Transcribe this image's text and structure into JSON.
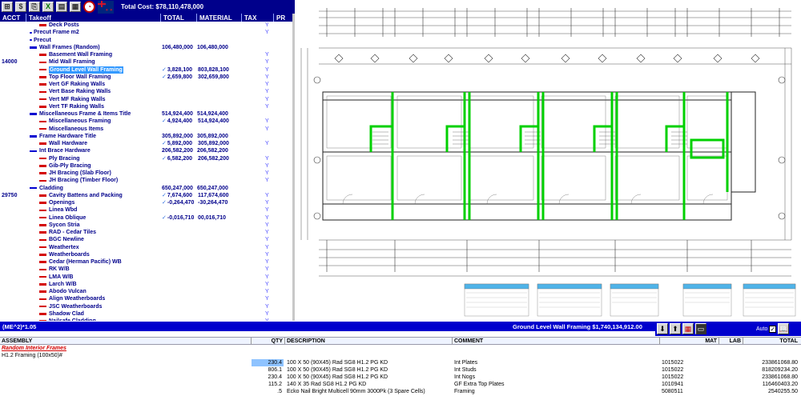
{
  "toolbar": {
    "total_cost": "Total Cost: $78,110,478,000"
  },
  "tree_header": {
    "acct": "ACCT",
    "takeoff": "Takeoff",
    "total": "TOTAL",
    "material": "MATERIAL",
    "tax": "TAX",
    "pr": "PR"
  },
  "tree_rows": [
    {
      "acct": "",
      "indent": 1,
      "bullet": "red",
      "name": "Deck Posts",
      "total": "",
      "material": "",
      "check": false,
      "y": "Y"
    },
    {
      "acct": "",
      "indent": 0,
      "bullet": "dot",
      "name": "Precut Frame m2",
      "total": "",
      "material": "",
      "check": false,
      "y": "Y"
    },
    {
      "acct": "",
      "indent": 0,
      "bullet": "dot",
      "name": "Precut",
      "total": "",
      "material": "",
      "check": false,
      "y": ""
    },
    {
      "acct": "",
      "indent": 0,
      "bullet": "blue",
      "name": "Wall Frames (Random)",
      "total": "106,480,000",
      "material": "106,480,000",
      "check": false,
      "y": ""
    },
    {
      "acct": "",
      "indent": 1,
      "bullet": "red",
      "name": "Basement Wall Framing",
      "total": "",
      "material": "",
      "check": false,
      "y": "Y"
    },
    {
      "acct": "14000",
      "indent": 1,
      "bullet": "red",
      "name": "Mid Wall Framing",
      "total": "",
      "material": "",
      "check": false,
      "y": "Y"
    },
    {
      "acct": "",
      "indent": 1,
      "bullet": "red",
      "name": "Ground Level Wall Framing",
      "total": "3,828,100",
      "material": "803,828,100",
      "check": true,
      "y": "Y",
      "selected": true
    },
    {
      "acct": "",
      "indent": 1,
      "bullet": "red",
      "name": "Top Floor Wall Framing",
      "total": "2,659,800",
      "material": "302,659,800",
      "check": true,
      "y": "Y"
    },
    {
      "acct": "",
      "indent": 1,
      "bullet": "red",
      "name": "Vert GF Raking Walls",
      "total": "",
      "material": "",
      "check": false,
      "y": "Y"
    },
    {
      "acct": "",
      "indent": 1,
      "bullet": "red",
      "name": "Vert Base Raking Walls",
      "total": "",
      "material": "",
      "check": false,
      "y": "Y"
    },
    {
      "acct": "",
      "indent": 1,
      "bullet": "red",
      "name": "Vert MF Raking Walls",
      "total": "",
      "material": "",
      "check": false,
      "y": "Y"
    },
    {
      "acct": "",
      "indent": 1,
      "bullet": "red",
      "name": "Vert TF Raking Walls",
      "total": "",
      "material": "",
      "check": false,
      "y": "Y"
    },
    {
      "acct": "",
      "indent": 0,
      "bullet": "blue",
      "name": "Miscellaneous Frame & Items Title",
      "total": "514,924,400",
      "material": "514,924,400",
      "check": false,
      "y": ""
    },
    {
      "acct": "",
      "indent": 1,
      "bullet": "red",
      "name": "Miscellaneous Framing",
      "total": "4,924,400",
      "material": "514,924,400",
      "check": true,
      "y": "Y"
    },
    {
      "acct": "",
      "indent": 1,
      "bullet": "red",
      "name": "Miscellaneous Items",
      "total": "",
      "material": "",
      "check": false,
      "y": "Y"
    },
    {
      "acct": "",
      "indent": 0,
      "bullet": "blue",
      "name": "Frame Hardware Title",
      "total": "305,892,000",
      "material": "305,892,000",
      "check": false,
      "y": ""
    },
    {
      "acct": "",
      "indent": 1,
      "bullet": "red",
      "name": "Wall Hardware",
      "total": "5,892,000",
      "material": "305,892,000",
      "check": true,
      "y": "Y"
    },
    {
      "acct": "",
      "indent": 0,
      "bullet": "blue",
      "name": "Int Brace Hardware",
      "total": "206,582,200",
      "material": "206,582,200",
      "check": false,
      "y": ""
    },
    {
      "acct": "",
      "indent": 1,
      "bullet": "red",
      "name": "Ply Bracing",
      "total": "6,582,200",
      "material": "206,582,200",
      "check": true,
      "y": "Y"
    },
    {
      "acct": "",
      "indent": 1,
      "bullet": "red",
      "name": "Gib-Ply Bracing",
      "total": "",
      "material": "",
      "check": false,
      "y": "Y"
    },
    {
      "acct": "",
      "indent": 1,
      "bullet": "red",
      "name": "JH Bracing (Slab Floor)",
      "total": "",
      "material": "",
      "check": false,
      "y": "Y"
    },
    {
      "acct": "",
      "indent": 1,
      "bullet": "red",
      "name": "JH Bracing (Timber Floor)",
      "total": "",
      "material": "",
      "check": false,
      "y": "Y"
    },
    {
      "acct": "",
      "indent": 0,
      "bullet": "blue",
      "name": "Cladding",
      "total": "650,247,000",
      "material": "650,247,000",
      "check": false,
      "y": ""
    },
    {
      "acct": "29750",
      "indent": 1,
      "bullet": "red",
      "name": "Cavity Battens and Packing",
      "total": "7,674,600",
      "material": "117,674,600",
      "check": true,
      "y": "Y"
    },
    {
      "acct": "",
      "indent": 1,
      "bullet": "red",
      "name": "Openings",
      "total": "-0,264,470",
      "material": "-30,264,470",
      "check": true,
      "y": "Y"
    },
    {
      "acct": "",
      "indent": 1,
      "bullet": "red",
      "name": "Linea Wbd",
      "total": "",
      "material": "",
      "check": false,
      "y": "Y"
    },
    {
      "acct": "",
      "indent": 1,
      "bullet": "red",
      "name": "Linea Oblique",
      "total": "-0,016,710",
      "material": "00,016,710",
      "check": true,
      "y": "Y"
    },
    {
      "acct": "",
      "indent": 1,
      "bullet": "red",
      "name": "Sycon Stria",
      "total": "",
      "material": "",
      "check": false,
      "y": "Y"
    },
    {
      "acct": "",
      "indent": 1,
      "bullet": "red",
      "name": "RAD - Cedar Tiles",
      "total": "",
      "material": "",
      "check": false,
      "y": "Y"
    },
    {
      "acct": "",
      "indent": 1,
      "bullet": "red",
      "name": "BGC Newline",
      "total": "",
      "material": "",
      "check": false,
      "y": "Y"
    },
    {
      "acct": "",
      "indent": 1,
      "bullet": "red",
      "name": "Weathertex",
      "total": "",
      "material": "",
      "check": false,
      "y": "Y"
    },
    {
      "acct": "",
      "indent": 1,
      "bullet": "red",
      "name": "Weatherboards",
      "total": "",
      "material": "",
      "check": false,
      "y": "Y"
    },
    {
      "acct": "",
      "indent": 1,
      "bullet": "red",
      "name": "Cedar (Herman Pacific) WB",
      "total": "",
      "material": "",
      "check": false,
      "y": "Y"
    },
    {
      "acct": "",
      "indent": 1,
      "bullet": "red",
      "name": "RK W/B",
      "total": "",
      "material": "",
      "check": false,
      "y": "Y"
    },
    {
      "acct": "",
      "indent": 1,
      "bullet": "red",
      "name": "LMA W/B",
      "total": "",
      "material": "",
      "check": false,
      "y": "Y"
    },
    {
      "acct": "",
      "indent": 1,
      "bullet": "red",
      "name": "Larch W/B",
      "total": "",
      "material": "",
      "check": false,
      "y": "Y"
    },
    {
      "acct": "",
      "indent": 1,
      "bullet": "red",
      "name": "Abodo Vulcan",
      "total": "",
      "material": "",
      "check": false,
      "y": "Y"
    },
    {
      "acct": "",
      "indent": 1,
      "bullet": "red",
      "name": "Align Weatherboards",
      "total": "",
      "material": "",
      "check": false,
      "y": "Y"
    },
    {
      "acct": "",
      "indent": 1,
      "bullet": "red",
      "name": "JSC Weatherboards",
      "total": "",
      "material": "",
      "check": false,
      "y": "Y"
    },
    {
      "acct": "",
      "indent": 1,
      "bullet": "red",
      "name": "Shadow Clad",
      "total": "",
      "material": "",
      "check": false,
      "y": "Y"
    },
    {
      "acct": "",
      "indent": 1,
      "bullet": "red",
      "name": "Nailsafe Cladding",
      "total": "",
      "material": "",
      "check": false,
      "y": "Y"
    }
  ],
  "status_bar": {
    "scale": "(ME^2)*1.05",
    "selected": "Ground Level Wall Framing $1,740,134,912.00"
  },
  "tools": {
    "auto_label": "Auto",
    "down_icon": "arrow-down-icon",
    "up_icon": "arrow-up-icon",
    "grid_icon": "grid-icon",
    "monitor_icon": "monitor-icon",
    "book_icon": "book-icon"
  },
  "assembly_header": {
    "assembly": "ASSEMBLY",
    "qty": "QTY",
    "description": "DESCRIPTION",
    "comment": "COMMENT",
    "mat": "MAT",
    "lab": "LAB",
    "total": "TOTAL"
  },
  "assembly": {
    "title": "Random Interior Frames",
    "subtitle": "H1.2  Framing (100x50)#",
    "rows": [
      {
        "qty": "230.4",
        "description": "100 X 50 (90X45) Rad SG8 H1.2 PG KD",
        "comment": "Int Plates",
        "mat": "1015022",
        "lab": "",
        "total": "233861068.80",
        "highlight": true
      },
      {
        "qty": "806.1",
        "description": "100 X 50 (90X45) Rad SG8 H1.2 PG KD",
        "comment": "Int Studs",
        "mat": "1015022",
        "lab": "",
        "total": "818209234.20",
        "highlight": false
      },
      {
        "qty": "230.4",
        "description": "100 X 50 (90X45) Rad SG8 H1.2 PG KD",
        "comment": "Int Nogs",
        "mat": "1015022",
        "lab": "",
        "total": "233861068.80",
        "highlight": false
      },
      {
        "qty": "115.2",
        "description": "140 X 35 Rad SG8 H1.2 PG KD",
        "comment": "GF Extra Top Plates",
        "mat": "1010941",
        "lab": "",
        "total": "116460403.20",
        "highlight": false
      },
      {
        "qty": ".5",
        "description": "Ecko Nail Bright Multicell 90mm 3000Pk (3 Spare Cells)",
        "comment": "Framing",
        "mat": "5080511",
        "lab": "",
        "total": "2540255.50",
        "highlight": false
      }
    ]
  },
  "colors": {
    "header_blue": "#00008b",
    "status_blue": "#0000cd",
    "bullet_red": "#d40000",
    "bullet_blue": "#0000d0",
    "selection": "#3399ff",
    "wall_green": "#00d000",
    "qty_highlight": "#8ec3ff",
    "assembly_title": "#d40000"
  }
}
